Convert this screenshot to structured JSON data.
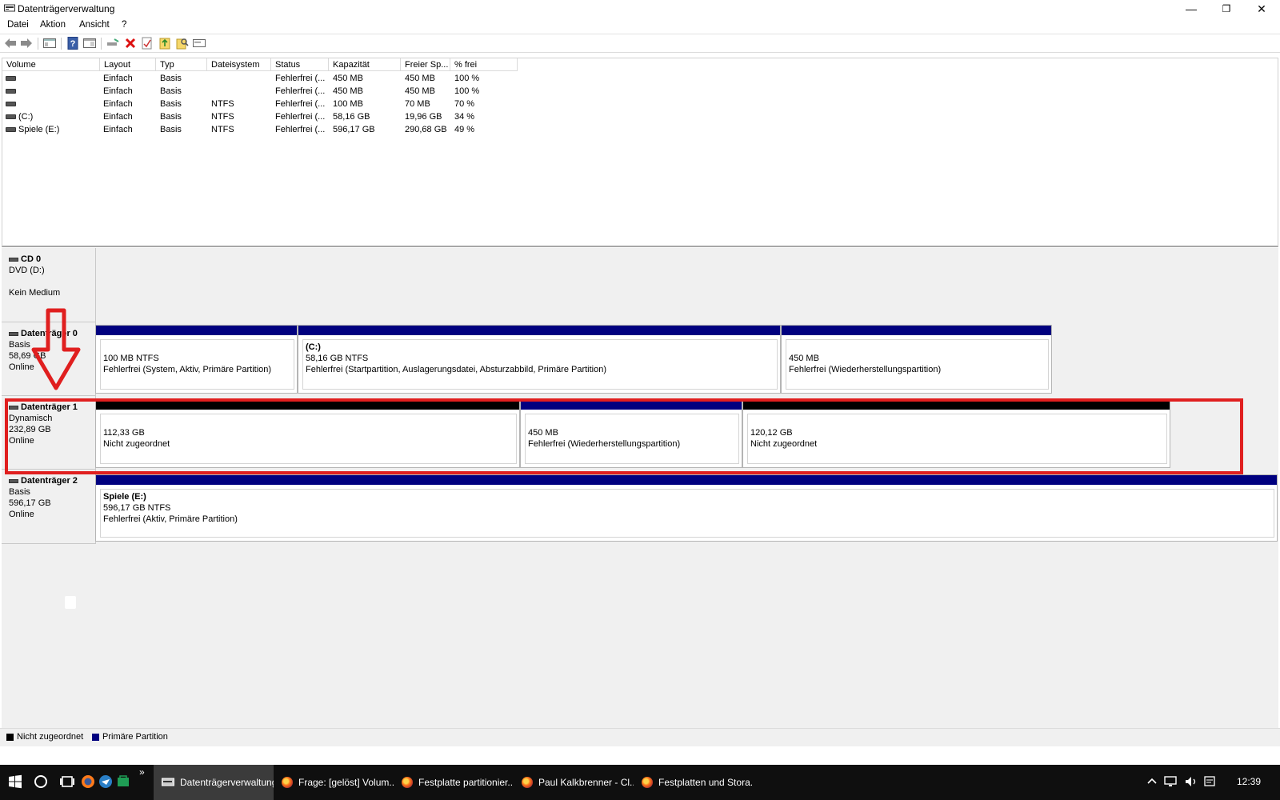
{
  "window": {
    "title": "Datenträgerverwaltung",
    "minimize": "—",
    "maximize": "❐",
    "close": "✕"
  },
  "menu": [
    "Datei",
    "Aktion",
    "Ansicht",
    "?"
  ],
  "volume_list": {
    "columns": [
      "Volume",
      "Layout",
      "Typ",
      "Dateisystem",
      "Status",
      "Kapazität",
      "Freier Sp...",
      "% frei"
    ],
    "rows": [
      {
        "volume": "",
        "layout": "Einfach",
        "typ": "Basis",
        "fs": "",
        "status": "Fehlerfrei (...",
        "kap": "450 MB",
        "frei": "450 MB",
        "pct": "100 %"
      },
      {
        "volume": "",
        "layout": "Einfach",
        "typ": "Basis",
        "fs": "",
        "status": "Fehlerfrei (...",
        "kap": "450 MB",
        "frei": "450 MB",
        "pct": "100 %"
      },
      {
        "volume": "",
        "layout": "Einfach",
        "typ": "Basis",
        "fs": "NTFS",
        "status": "Fehlerfrei (...",
        "kap": "100 MB",
        "frei": "70 MB",
        "pct": "70 %"
      },
      {
        "volume": "(C:)",
        "layout": "Einfach",
        "typ": "Basis",
        "fs": "NTFS",
        "status": "Fehlerfrei (...",
        "kap": "58,16 GB",
        "frei": "19,96 GB",
        "pct": "34 %"
      },
      {
        "volume": "Spiele (E:)",
        "layout": "Einfach",
        "typ": "Basis",
        "fs": "NTFS",
        "status": "Fehlerfrei (...",
        "kap": "596,17 GB",
        "frei": "290,68 GB",
        "pct": "49 %"
      }
    ]
  },
  "disks": {
    "cd0": {
      "name": "CD 0",
      "line1": "DVD (D:)",
      "line3": "Kein Medium"
    },
    "disk0": {
      "name": "Datenträger 0",
      "type": "Basis",
      "size": "58,69 GB",
      "state": "Online",
      "partitions": [
        {
          "name": "",
          "size": "100 MB NTFS",
          "status": "Fehlerfrei (System, Aktiv, Primäre Partition)"
        },
        {
          "name": "(C:)",
          "size": "58,16 GB NTFS",
          "status": "Fehlerfrei (Startpartition, Auslagerungsdatei, Absturzabbild, Primäre Partition)"
        },
        {
          "name": "",
          "size": "450 MB",
          "status": "Fehlerfrei (Wiederherstellungspartition)"
        }
      ]
    },
    "disk1": {
      "name": "Datenträger 1",
      "type": "Dynamisch",
      "size": "232,89 GB",
      "state": "Online",
      "partitions": [
        {
          "size": "112,33 GB",
          "status": "Nicht zugeordnet"
        },
        {
          "size": "450 MB",
          "status": "Fehlerfrei (Wiederherstellungspartition)"
        },
        {
          "size": "120,12 GB",
          "status": "Nicht zugeordnet"
        }
      ]
    },
    "disk2": {
      "name": "Datenträger 2",
      "type": "Basis",
      "size": "596,17 GB",
      "state": "Online",
      "partitions": [
        {
          "name": "Spiele  (E:)",
          "size": "596,17 GB NTFS",
          "status": "Fehlerfrei (Aktiv, Primäre Partition)"
        }
      ]
    }
  },
  "legend": [
    {
      "label": "Nicht zugeordnet",
      "color": "#000000"
    },
    {
      "label": "Primäre Partition",
      "color": "#00007f"
    }
  ],
  "taskbar": {
    "tasks": [
      "Datenträgerverwaltung",
      "Frage: [gelöst] Volum...",
      "Festplatte partitionier...",
      "Paul Kalkbrenner - Cl...",
      "Festplatten und Stora..."
    ],
    "clock": "12:39"
  },
  "colors": {
    "primary_partition": "#00007f",
    "unallocated": "#000000",
    "annotation": "#e01f1f"
  }
}
